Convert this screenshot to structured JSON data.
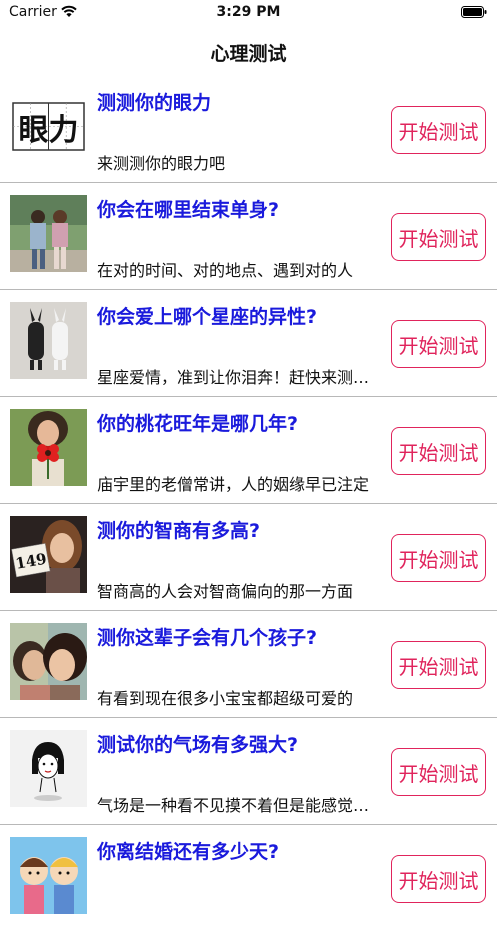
{
  "status_bar": {
    "carrier": "Carrier",
    "time": "3:29 PM"
  },
  "nav": {
    "title": "心理测试"
  },
  "items": [
    {
      "title": "测测你的眼力",
      "desc": "来测测你的眼力吧",
      "button": "开始测试",
      "thumb_text": "眼力",
      "thumb_icon": "eyesight-text-image"
    },
    {
      "title": "你会在哪里结束单身?",
      "desc": "在对的时间、对的地点、遇到对的人",
      "button": "开始测试",
      "thumb_icon": "couple-photo"
    },
    {
      "title": "你会爱上哪个星座的异性?",
      "desc": "星座爱情，准到让你泪奔！赶快来测测吧",
      "button": "开始测试",
      "thumb_icon": "bunny-couple-image"
    },
    {
      "title": "你的桃花旺年是哪几年?",
      "desc": "庙宇里的老僧常讲，人的姻缘早已注定",
      "button": "开始测试",
      "thumb_icon": "girl-with-flower-photo"
    },
    {
      "title": "测你的智商有多高?",
      "desc": "智商高的人会对智商偏向的那一方面",
      "button": "开始测试",
      "thumb_text": "149",
      "thumb_icon": "girl-with-sign-photo"
    },
    {
      "title": "测你这辈子会有几个孩子?",
      "desc": "有看到现在很多小宝宝都超级可爱的",
      "button": "开始测试",
      "thumb_icon": "kids-photo"
    },
    {
      "title": "测试你的气场有多强大?",
      "desc": "气场是一种看不见摸不着但是能感觉到的",
      "button": "开始测试",
      "thumb_icon": "girl-sketch-image"
    },
    {
      "title": "你离结婚还有多少天?",
      "desc": "",
      "button": "开始测试",
      "thumb_icon": "cartoon-kids-image"
    }
  ]
}
